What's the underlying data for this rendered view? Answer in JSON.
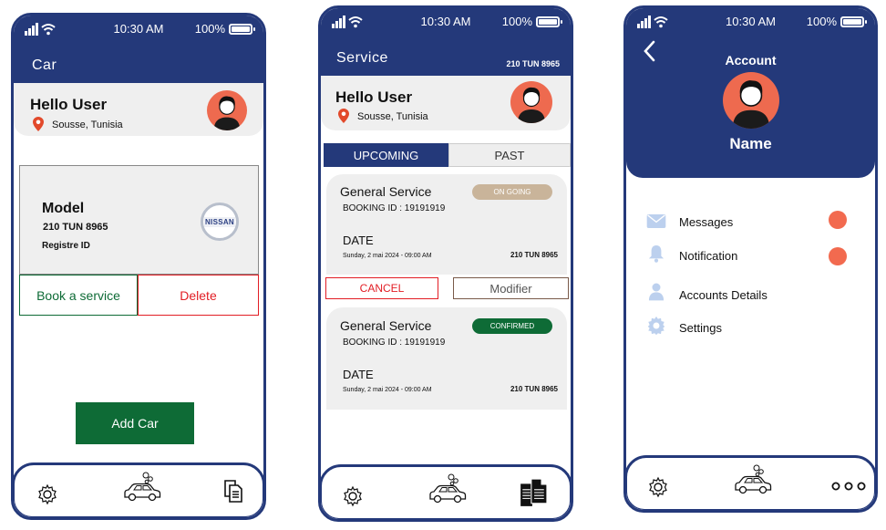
{
  "status": {
    "time": "10:30 AM",
    "battery": "100%"
  },
  "phone1": {
    "title": "Car",
    "greeting": "Hello User",
    "location": "Sousse, Tunisia",
    "car": {
      "model_label": "Model",
      "plate": "210 TUN 8965",
      "registre_label": "Registre ID",
      "brand_logo": "NISSAN"
    },
    "book_service_label": "Book a service",
    "delete_label": "Delete",
    "add_car_label": "Add Car"
  },
  "phone2": {
    "title": "Service",
    "plate": "210 TUN 8965",
    "greeting": "Hello User",
    "location": "Sousse, Tunisia",
    "tabs": {
      "upcoming": "UPCOMING",
      "past": "PAST"
    },
    "bookings": [
      {
        "service": "General Service",
        "status": "ON GOING",
        "booking_id": "BOOKING ID : 19191919",
        "date_label": "DATE",
        "date": "Sunday, 2 mai 2024 - 09:00 AM",
        "plate": "210 TUN 8965"
      },
      {
        "service": "General Service",
        "status": "CONFIRMED",
        "booking_id": "BOOKING ID : 19191919",
        "date_label": "DATE",
        "date": "Sunday, 2 mai 2024 - 09:00 AM",
        "plate": "210 TUN 8965"
      }
    ],
    "cancel_label": "CANCEL",
    "modify_label": "Modifier"
  },
  "phone3": {
    "title": "Account",
    "name": "Name",
    "menu": [
      {
        "label": "Messages",
        "icon": "envelope-icon"
      },
      {
        "label": "Notification",
        "icon": "bell-icon"
      },
      {
        "label": "Accounts Details",
        "icon": "user-icon"
      },
      {
        "label": "Settings",
        "icon": "gear-icon"
      }
    ]
  },
  "colors": {
    "navy": "#24397a",
    "green": "#0e6b36",
    "red": "#e21d24",
    "coral": "#f26a4f",
    "ongoing_badge": "#c9b49a",
    "confirmed_badge": "#0e6b36",
    "icon_light": "#bcd0ee"
  }
}
